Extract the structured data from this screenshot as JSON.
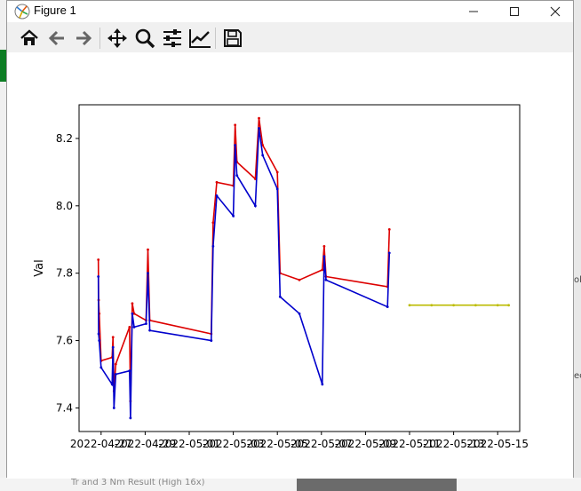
{
  "window": {
    "title": "Figure 1"
  },
  "toolbar": {
    "tools": [
      {
        "name": "home",
        "icon": "home-icon"
      },
      {
        "name": "back",
        "icon": "arrow-left-icon"
      },
      {
        "name": "forward",
        "icon": "arrow-right-icon"
      },
      {
        "name": "pan",
        "icon": "move-icon"
      },
      {
        "name": "zoom",
        "icon": "magnifier-icon"
      },
      {
        "name": "configure subplots",
        "icon": "sliders-icon"
      },
      {
        "name": "edit axis",
        "icon": "line-chart-icon"
      },
      {
        "name": "save",
        "icon": "floppy-disk-icon"
      }
    ]
  },
  "background": {
    "bottom_text": "Tr and 3 Nm Result (High 16x)"
  },
  "chart_data": {
    "type": "line",
    "ylabel": "Val",
    "xlabel": "",
    "ylim": [
      7.33,
      8.3
    ],
    "yticks": [
      "7.4",
      "7.6",
      "7.8",
      "8.0",
      "8.2"
    ],
    "xticks": [
      "2022-04-27",
      "2022-04-29",
      "2022-05-01",
      "2022-05-03",
      "2022-05-05",
      "2022-05-07",
      "2022-05-09",
      "2022-05-11",
      "2022-05-13",
      "2022-05-15"
    ],
    "xlim": [
      "2022-04-26",
      "2022-05-16"
    ],
    "series": [
      {
        "color": "#dd0000",
        "points": [
          [
            "2022-04-26 21:00",
            7.84
          ],
          [
            "2022-04-26 21:20",
            7.72
          ],
          [
            "2022-04-26 22:00",
            7.68
          ],
          [
            "2022-04-27 00:00",
            7.54
          ],
          [
            "2022-04-27 12:00",
            7.55
          ],
          [
            "2022-04-27 13:00",
            7.61
          ],
          [
            "2022-04-27 14:00",
            7.45
          ],
          [
            "2022-04-27 16:00",
            7.53
          ],
          [
            "2022-04-28 07:00",
            7.64
          ],
          [
            "2022-04-28 08:00",
            7.42
          ],
          [
            "2022-04-28 10:00",
            7.71
          ],
          [
            "2022-04-28 12:00",
            7.68
          ],
          [
            "2022-04-29 01:00",
            7.66
          ],
          [
            "2022-04-29 03:00",
            7.87
          ],
          [
            "2022-04-29 05:00",
            7.66
          ],
          [
            "2022-05-02 00:00",
            7.62
          ],
          [
            "2022-05-02 02:00",
            7.95
          ],
          [
            "2022-05-02 06:00",
            8.07
          ],
          [
            "2022-05-03 00:00",
            8.06
          ],
          [
            "2022-05-03 02:00",
            8.24
          ],
          [
            "2022-05-03 04:00",
            8.13
          ],
          [
            "2022-05-04 00:00",
            8.08
          ],
          [
            "2022-05-04 04:00",
            8.26
          ],
          [
            "2022-05-04 08:00",
            8.18
          ],
          [
            "2022-05-05 00:00",
            8.1
          ],
          [
            "2022-05-05 03:00",
            7.8
          ],
          [
            "2022-05-06 00:00",
            7.78
          ],
          [
            "2022-05-07 01:00",
            7.81
          ],
          [
            "2022-05-07 03:00",
            7.88
          ],
          [
            "2022-05-07 05:00",
            7.79
          ],
          [
            "2022-05-10 00:00",
            7.76
          ],
          [
            "2022-05-10 02:00",
            7.93
          ]
        ]
      },
      {
        "color": "#0000cc",
        "points": [
          [
            "2022-04-26 21:00",
            7.79
          ],
          [
            "2022-04-26 21:20",
            7.62
          ],
          [
            "2022-04-26 22:00",
            7.6
          ],
          [
            "2022-04-27 00:00",
            7.52
          ],
          [
            "2022-04-27 12:00",
            7.47
          ],
          [
            "2022-04-27 13:00",
            7.58
          ],
          [
            "2022-04-27 14:00",
            7.4
          ],
          [
            "2022-04-27 16:00",
            7.5
          ],
          [
            "2022-04-28 07:00",
            7.51
          ],
          [
            "2022-04-28 08:00",
            7.37
          ],
          [
            "2022-04-28 10:00",
            7.68
          ],
          [
            "2022-04-28 12:00",
            7.64
          ],
          [
            "2022-04-29 01:00",
            7.65
          ],
          [
            "2022-04-29 03:00",
            7.8
          ],
          [
            "2022-04-29 05:00",
            7.63
          ],
          [
            "2022-05-02 00:00",
            7.6
          ],
          [
            "2022-05-02 02:00",
            7.88
          ],
          [
            "2022-05-02 06:00",
            8.03
          ],
          [
            "2022-05-03 00:00",
            7.97
          ],
          [
            "2022-05-03 02:00",
            8.18
          ],
          [
            "2022-05-03 04:00",
            8.09
          ],
          [
            "2022-05-04 00:00",
            8.0
          ],
          [
            "2022-05-04 04:00",
            8.23
          ],
          [
            "2022-05-04 08:00",
            8.15
          ],
          [
            "2022-05-05 00:00",
            8.05
          ],
          [
            "2022-05-05 03:00",
            7.73
          ],
          [
            "2022-05-06 00:00",
            7.68
          ],
          [
            "2022-05-07 01:00",
            7.47
          ],
          [
            "2022-05-07 03:00",
            7.85
          ],
          [
            "2022-05-07 05:00",
            7.78
          ],
          [
            "2022-05-10 00:00",
            7.7
          ],
          [
            "2022-05-10 02:00",
            7.86
          ]
        ]
      },
      {
        "color": "#bbbb00",
        "points": [
          [
            "2022-05-11 00:00",
            7.705
          ],
          [
            "2022-05-12 00:00",
            7.705
          ],
          [
            "2022-05-13 00:00",
            7.705
          ],
          [
            "2022-05-14 00:00",
            7.705
          ],
          [
            "2022-05-15 00:00",
            7.705
          ],
          [
            "2022-05-15 12:00",
            7.705
          ]
        ]
      }
    ]
  }
}
